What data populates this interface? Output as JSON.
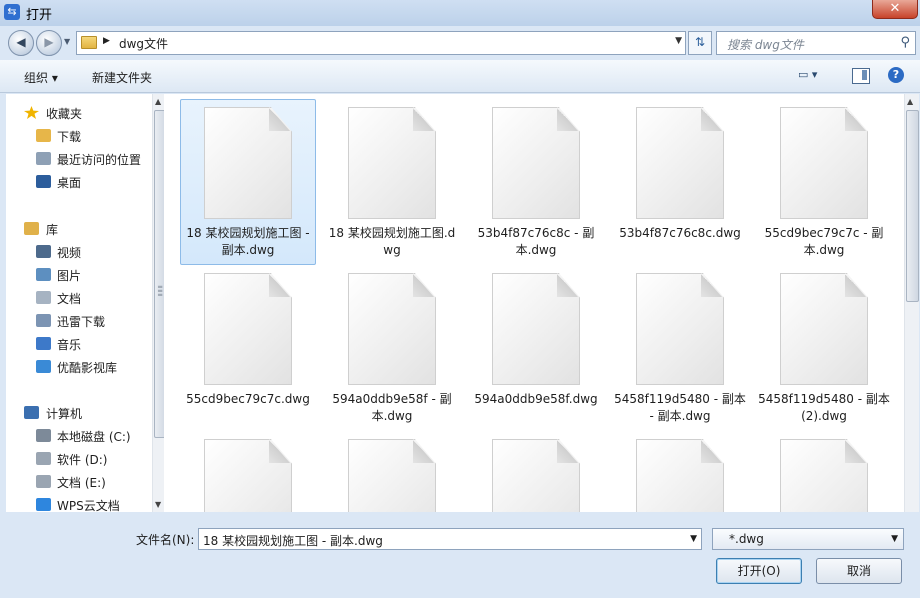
{
  "window": {
    "title": "打开",
    "close_glyph": "✕"
  },
  "nav": {
    "back_glyph": "◀",
    "forward_glyph": "▶",
    "address": "dwg文件",
    "search_placeholder": "搜索 dwg文件"
  },
  "toolbar": {
    "organize": "组织 ▾",
    "new_folder": "新建文件夹"
  },
  "sidebar": {
    "favorites": {
      "label": "收藏夹",
      "icon": "star-icon",
      "color": "#f0b400"
    },
    "favorites_items": [
      {
        "label": "下载",
        "icon": "download-folder-icon",
        "color": "#e7b649"
      },
      {
        "label": "最近访问的位置",
        "icon": "recent-places-icon",
        "color": "#8ea0b5"
      },
      {
        "label": "桌面",
        "icon": "desktop-icon",
        "color": "#2c5d9c"
      }
    ],
    "libraries": {
      "label": "库",
      "icon": "library-icon",
      "color": "#e0b14a"
    },
    "library_items": [
      {
        "label": "视频",
        "icon": "video-icon",
        "color": "#4d6a8c"
      },
      {
        "label": "图片",
        "icon": "picture-icon",
        "color": "#5d8fc0"
      },
      {
        "label": "文档",
        "icon": "document-icon",
        "color": "#a6b3c2"
      },
      {
        "label": "迅雷下载",
        "icon": "thunder-download-icon",
        "color": "#7c94b3"
      },
      {
        "label": "音乐",
        "icon": "music-icon",
        "color": "#3d79c9"
      },
      {
        "label": "优酷影视库",
        "icon": "youku-library-icon",
        "color": "#3a8ad6"
      }
    ],
    "computer": {
      "label": "计算机",
      "icon": "computer-icon",
      "color": "#3b6fb0"
    },
    "computer_items": [
      {
        "label": "本地磁盘 (C:)",
        "icon": "system-drive-icon",
        "color": "#7d8a99"
      },
      {
        "label": "软件 (D:)",
        "icon": "drive-icon",
        "color": "#9aa5b2"
      },
      {
        "label": "文档 (E:)",
        "icon": "drive-icon",
        "color": "#9aa5b2"
      },
      {
        "label": "WPS云文档",
        "icon": "cloud-icon",
        "color": "#2e86de"
      }
    ]
  },
  "files": [
    {
      "name": "18 某校园规划施工图 - 副本.dwg",
      "selected": true
    },
    {
      "name": "18 某校园规划施工图.dwg",
      "selected": false
    },
    {
      "name": "53b4f87c76c8c - 副本.dwg",
      "selected": false
    },
    {
      "name": "53b4f87c76c8c.dwg",
      "selected": false
    },
    {
      "name": "55cd9bec79c7c - 副本.dwg",
      "selected": false
    },
    {
      "name": "55cd9bec79c7c.dwg",
      "selected": false
    },
    {
      "name": "594a0ddb9e58f - 副本.dwg",
      "selected": false
    },
    {
      "name": "594a0ddb9e58f.dwg",
      "selected": false
    },
    {
      "name": "5458f119d5480 - 副本 - 副本.dwg",
      "selected": false
    },
    {
      "name": "5458f119d5480 - 副本 (2).dwg",
      "selected": false
    },
    {
      "name": "",
      "selected": false
    },
    {
      "name": "",
      "selected": false
    },
    {
      "name": "",
      "selected": false
    },
    {
      "name": "",
      "selected": false
    },
    {
      "name": "",
      "selected": false
    }
  ],
  "bottom": {
    "filename_label": "文件名(N):",
    "filename_value": "18 某校园规划施工图 - 副本.dwg",
    "filetype_value": "*.dwg",
    "open_label": "打开(O)",
    "cancel_label": "取消"
  }
}
